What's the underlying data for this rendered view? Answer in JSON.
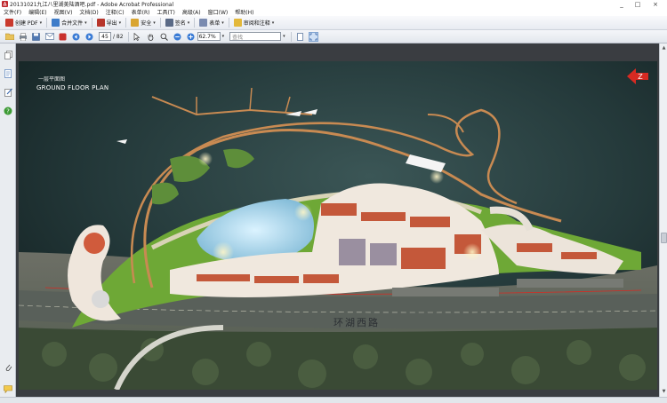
{
  "window": {
    "title": "20131021九江八里湖美陆酒吧.pdf - Adobe Acrobat Professional",
    "controls": [
      "_",
      "□",
      "×"
    ]
  },
  "menubar": {
    "items": [
      "文件(F)",
      "编辑(E)",
      "视图(V)",
      "文档(D)",
      "注释(C)",
      "表单(R)",
      "工具(T)",
      "高级(A)",
      "窗口(W)",
      "帮助(H)"
    ]
  },
  "toolbar1": {
    "create_pdf": "创建 PDF",
    "merge_files": "合并文件",
    "export": "导出",
    "security": "安全",
    "sign": "签名",
    "forms": "表单",
    "review_comment": "审阅和注释"
  },
  "toolbar2": {
    "page_number": "45",
    "page_total": "/ 82",
    "zoom": "62.7%",
    "find_placeholder": "查找"
  },
  "document": {
    "plan_title_cn": "一层平面图",
    "plan_title_en": "GROUND FLOOR PLAN",
    "road_label": "环湖西路"
  },
  "colors": {
    "accent_red": "#d72a22",
    "water": "#24393a",
    "grass": "#6ea836",
    "deck_wood": "#c88a52"
  },
  "icons": {
    "north_arrow": "north-arrow-icon",
    "pages_panel": "pages-panel-icon",
    "bookmarks_panel": "bookmarks-panel-icon",
    "signatures_panel": "signatures-panel-icon",
    "help": "help-icon",
    "attachments": "paperclip-icon",
    "comments": "comment-icon"
  }
}
